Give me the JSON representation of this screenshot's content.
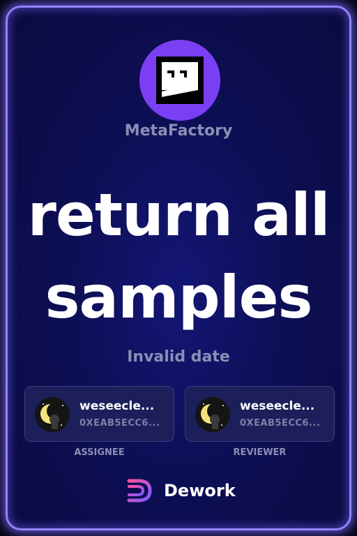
{
  "org": {
    "name": "MetaFactory",
    "logo_icon": "metafactory-logo-icon",
    "accent": "#7b3ff3"
  },
  "task": {
    "title_line1": "return all",
    "title_line2": "samples",
    "date": "Invalid date"
  },
  "assignee": {
    "name": "weseecle...",
    "address": "0XEAB5ECC6...",
    "role": "ASSIGNEE"
  },
  "reviewer": {
    "name": "weseecle...",
    "address": "0XEAB5ECC6...",
    "role": "REVIEWER"
  },
  "brand": {
    "name": "Dework",
    "logo_icon": "dework-logo-icon"
  },
  "colors": {
    "background": "#0d0f55",
    "border_glow": "#8f83ff",
    "muted_text": "#8a8fb4"
  }
}
